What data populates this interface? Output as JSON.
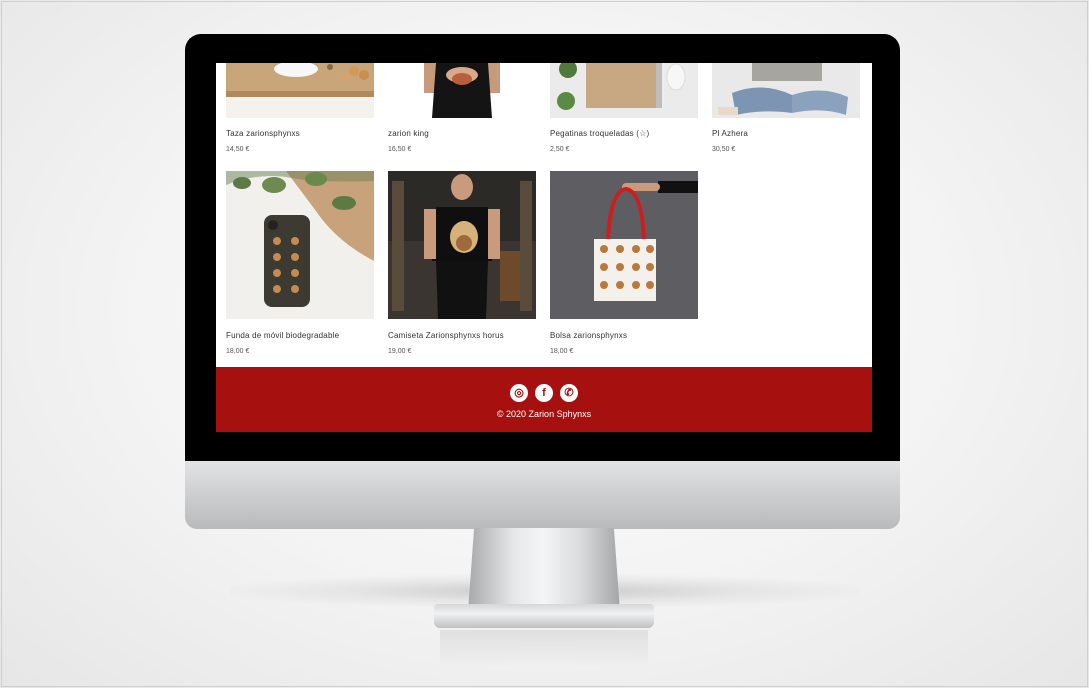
{
  "shop": {
    "row1": [
      {
        "name": "Taza zarionsphynxs",
        "price": "14,50 €"
      },
      {
        "name": "zarion king",
        "price": "16,50 €"
      },
      {
        "name": "Pegatinas troqueladas (☆)",
        "price": "2,50 €"
      },
      {
        "name": "Pl Azhera",
        "price": "30,50 €"
      }
    ],
    "row2": [
      {
        "name": "Funda de móvil biodegradable",
        "price": "18,00 €"
      },
      {
        "name": "Camiseta Zarionsphynxs horus",
        "price": "19,00 €"
      },
      {
        "name": "Bolsa zarionsphynxs",
        "price": "18,00 €"
      }
    ]
  },
  "footer": {
    "social": [
      {
        "icon": "instagram-icon",
        "glyph": "◎"
      },
      {
        "icon": "facebook-icon",
        "glyph": "f"
      },
      {
        "icon": "whatsapp-icon",
        "glyph": "✆"
      }
    ],
    "copyright": "© 2020 Zarion Sphynxs"
  },
  "colors": {
    "footer_bg": "#a6110f",
    "bezel": "#000000"
  }
}
